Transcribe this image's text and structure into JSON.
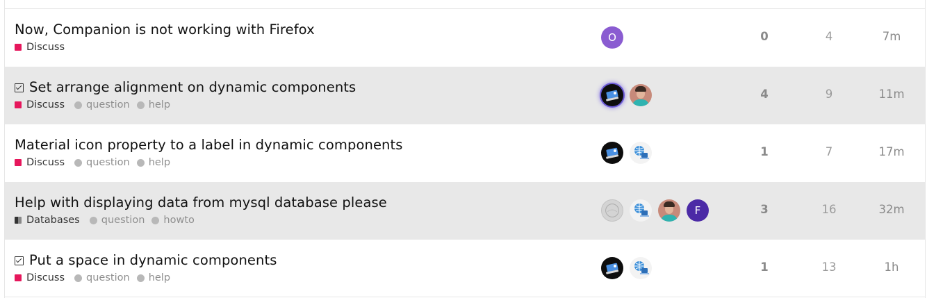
{
  "topics": [
    {
      "title": "Now, Companion is not working with Firefox",
      "solved": false,
      "category": "Discuss",
      "tags": [],
      "posters": [
        {
          "type": "letter",
          "text": "O",
          "icon": "letter-avatar-o"
        }
      ],
      "replies": "0",
      "views": "4",
      "activity": "7m"
    },
    {
      "title": "Set arrange alignment on dynamic components",
      "solved": true,
      "category": "Discuss",
      "tags": [
        "question",
        "help"
      ],
      "posters": [
        {
          "type": "dark",
          "icon": "user-avatar-dark"
        },
        {
          "type": "photo",
          "icon": "user-avatar-photo"
        }
      ],
      "replies": "4",
      "views": "9",
      "activity": "11m"
    },
    {
      "title": "Material icon property to a label in dynamic components",
      "solved": false,
      "category": "Discuss",
      "tags": [
        "question",
        "help"
      ],
      "posters": [
        {
          "type": "dark",
          "icon": "user-avatar-dark"
        },
        {
          "type": "globe",
          "icon": "user-avatar-globe"
        }
      ],
      "replies": "1",
      "views": "7",
      "activity": "17m"
    },
    {
      "title": "Help with displaying data from mysql database please",
      "solved": false,
      "category": "Databases",
      "tags": [
        "question",
        "howto"
      ],
      "posters": [
        {
          "type": "grey",
          "icon": "user-avatar-grey"
        },
        {
          "type": "globe",
          "icon": "user-avatar-globe"
        },
        {
          "type": "photo",
          "icon": "user-avatar-photo"
        },
        {
          "type": "letter",
          "text": "F",
          "icon": "letter-avatar-f"
        }
      ],
      "replies": "3",
      "views": "16",
      "activity": "32m"
    },
    {
      "title": "Put a space in dynamic components",
      "solved": true,
      "category": "Discuss",
      "tags": [
        "question",
        "help"
      ],
      "posters": [
        {
          "type": "dark",
          "icon": "user-avatar-dark"
        },
        {
          "type": "globe",
          "icon": "user-avatar-globe"
        }
      ],
      "replies": "1",
      "views": "13",
      "activity": "1h"
    }
  ],
  "colors": {
    "discuss_category": "#e6175c",
    "tag_dot": "#b8b8b8",
    "alt_row": "#e8e8e8",
    "letter_avatar_o": "#8a5cd1",
    "letter_avatar_f": "#4b2aa6"
  }
}
